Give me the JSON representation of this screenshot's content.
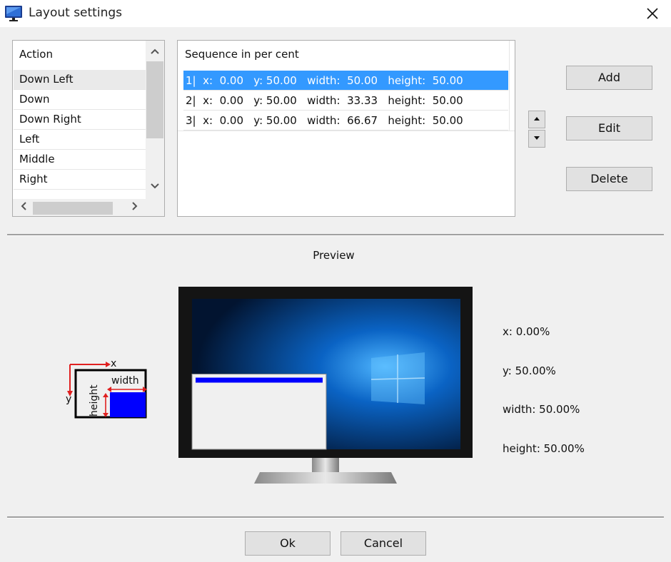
{
  "window": {
    "title": "Layout settings",
    "app_icon": "monitor-icon",
    "close_icon": "close-icon"
  },
  "action_list": {
    "header": "Action",
    "items": [
      {
        "label": "Down Left",
        "selected": true
      },
      {
        "label": "Down",
        "selected": false
      },
      {
        "label": "Down Right",
        "selected": false
      },
      {
        "label": "Left",
        "selected": false
      },
      {
        "label": "Middle",
        "selected": false
      },
      {
        "label": "Right",
        "selected": false
      }
    ],
    "scroll_up_icon": "chevron-up-icon",
    "scroll_down_icon": "chevron-down-icon",
    "scroll_left_icon": "chevron-left-icon",
    "scroll_right_icon": "chevron-right-icon"
  },
  "sequence": {
    "header": "Sequence in per cent",
    "rows": [
      {
        "text": "1|  x:  0.00   y: 50.00   width:  50.00   height:  50.00",
        "selected": true
      },
      {
        "text": "2|  x:  0.00   y: 50.00   width:  33.33   height:  50.00",
        "selected": false
      },
      {
        "text": "3|  x:  0.00   y: 50.00   width:  66.67   height:  50.00",
        "selected": false
      }
    ],
    "move_up_icon": "triangle-up-icon",
    "move_down_icon": "triangle-down-icon"
  },
  "buttons": {
    "add": "Add",
    "edit": "Edit",
    "delete": "Delete",
    "ok": "Ok",
    "cancel": "Cancel"
  },
  "preview": {
    "label": "Preview",
    "legend": {
      "x": "x",
      "y": "y",
      "width": "width",
      "height": "height"
    },
    "x": "x: 0.00%",
    "y": "y: 50.00%",
    "width": "width: 50.00%",
    "height": "height: 50.00%",
    "window_x_pct": 0,
    "window_y_pct": 50,
    "window_w_pct": 50,
    "window_h_pct": 50
  },
  "colors": {
    "selection": "#3399ff",
    "preview_accent": "#0000ff",
    "legend_arrows": "#e02020"
  }
}
